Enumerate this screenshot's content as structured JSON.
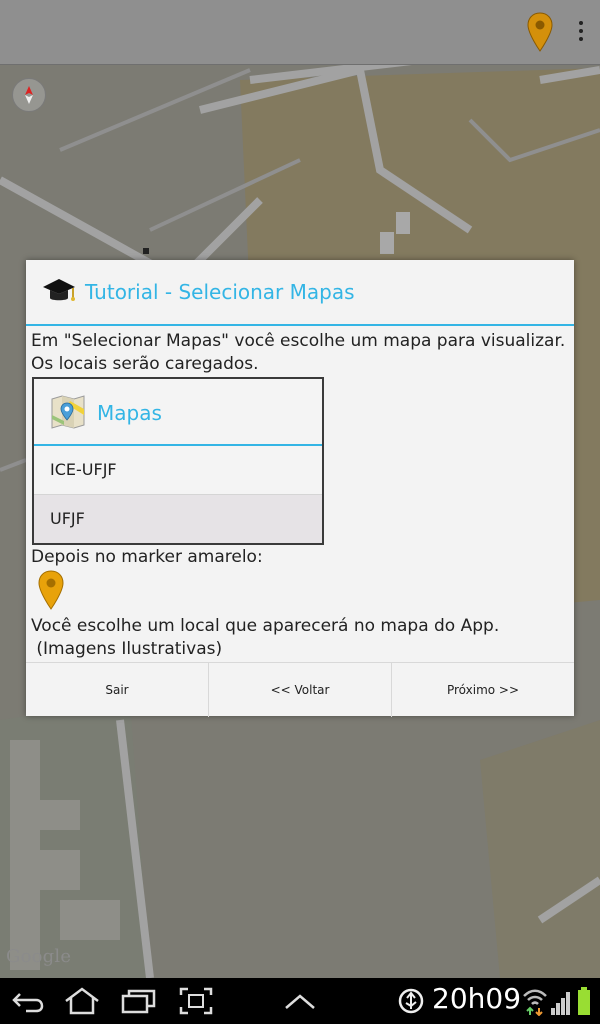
{
  "dialog": {
    "title": "Tutorial - Selecionar Mapas",
    "text1": "Em \"Selecionar Mapas\" você escolhe um mapa para visualizar. Os locais serão caregados.",
    "sample_dialog": {
      "title": "Mapas",
      "items": [
        "ICE-UFJF",
        "UFJF"
      ]
    },
    "text2": "Depois no marker amarelo:",
    "text3": "Você escolhe um local que aparecerá no mapa do App.\n (Imagens Ilustrativas)",
    "buttons": {
      "exit": "Sair",
      "back": "<< Voltar",
      "next": "Próximo >>"
    }
  },
  "map": {
    "attribution": "Google"
  },
  "status_bar": {
    "time": "20h09"
  },
  "colors": {
    "accent": "#33b5e5",
    "marker": "#e8a20a"
  },
  "icons": [
    "marker-icon",
    "overflow-menu-icon",
    "compass-icon",
    "graduation-cap-icon",
    "maps-icon",
    "back-icon",
    "home-icon",
    "recent-apps-icon",
    "screenshot-icon",
    "up-chevron-icon",
    "usb-debug-icon",
    "wifi-icon",
    "signal-icon",
    "battery-icon"
  ]
}
